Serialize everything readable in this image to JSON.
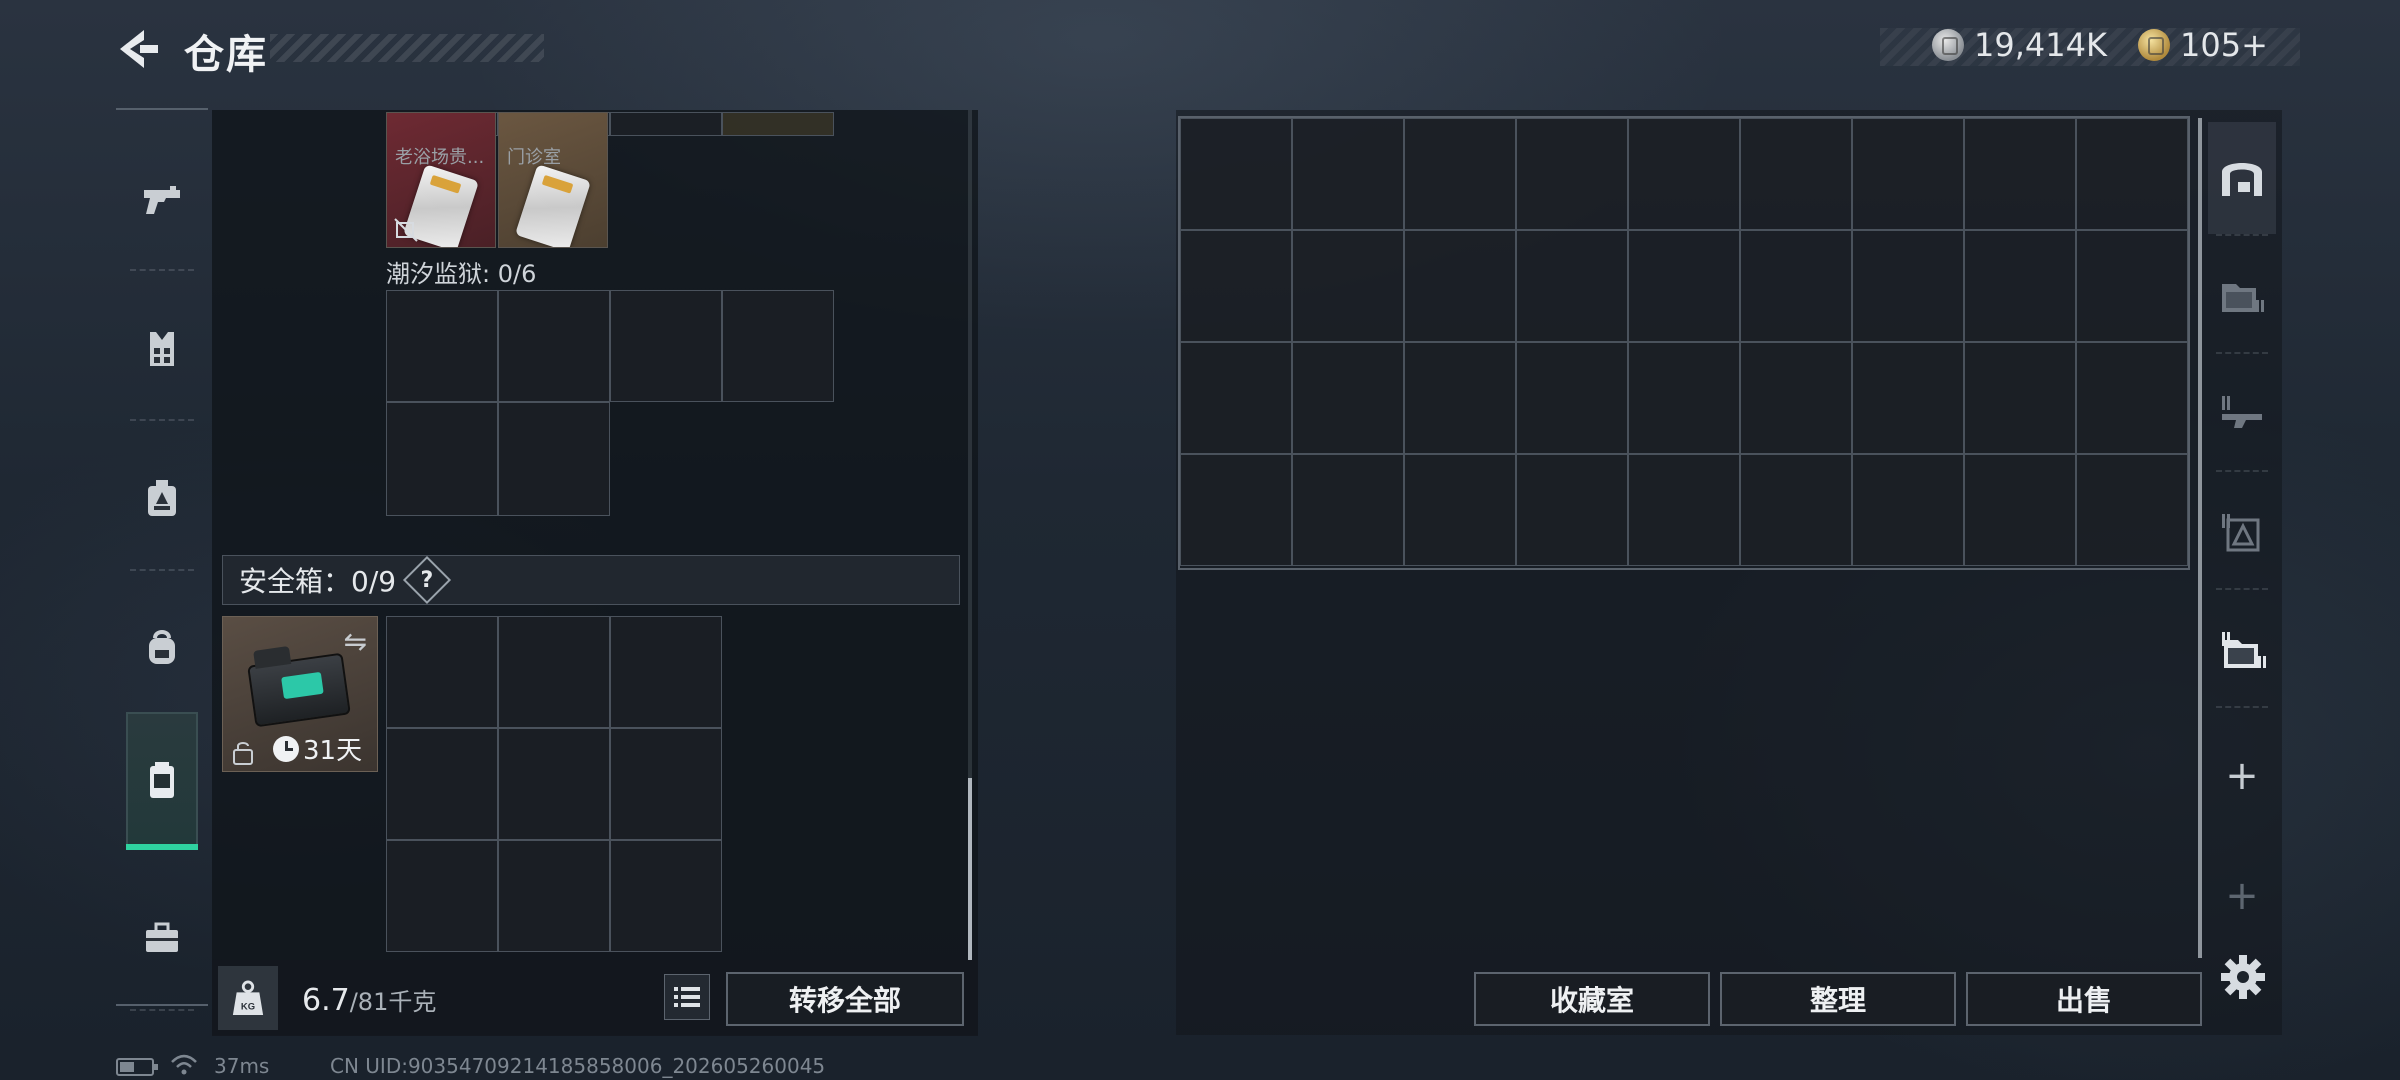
{
  "header": {
    "title": "仓库",
    "currency_silver": "19,414K",
    "currency_gold": "105+"
  },
  "left_tabs": [
    "weapon-icon",
    "armor-vest-icon",
    "chest-rig-icon",
    "backpack-icon",
    "container-icon",
    "toolbox-icon"
  ],
  "upper_items": [
    {
      "name": "老浴场贵...",
      "color": "#6e2a33"
    },
    {
      "name": "门诊室",
      "color": "#6b5741"
    }
  ],
  "prison_label": "潮汐监狱: 0/6",
  "safe_box": {
    "label": "安全箱：0/9",
    "help": "?",
    "timer": "31天"
  },
  "weight": {
    "current": "6.7",
    "max": "/81千克"
  },
  "buttons": {
    "transfer_all": "转移全部",
    "collection_room": "收藏室",
    "organize": "整理",
    "sell": "出售"
  },
  "right_tabs": [
    "stash-home-icon",
    "stash-folder-icon",
    "weapon-stash-icon",
    "armor-stash-icon",
    "item-folder-icon"
  ],
  "plus_label": "+",
  "status": {
    "ping": "37ms",
    "uid": "CN UID:90354709214185858006_202605260045"
  },
  "colors": {
    "accent_green": "#2fd3a0",
    "border": "#4b535c"
  }
}
